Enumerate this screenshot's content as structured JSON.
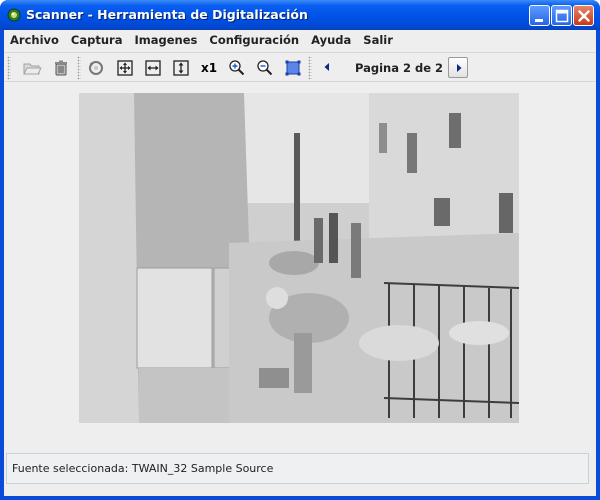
{
  "window": {
    "title": "Scanner - Herramienta de Digitalización"
  },
  "menu": [
    "Archivo",
    "Captura",
    "Imagenes",
    "Configuración",
    "Ayuda",
    "Salir"
  ],
  "toolbar": {
    "zoom_actual_label": "x1",
    "page_label": "Pagina 2 de 2"
  },
  "status": {
    "text": "Fuente seleccionada: TWAIN_32 Sample Source"
  },
  "colors": {
    "title_bar": "#0052e7",
    "close_button": "#c8391b",
    "client_bg": "#eeeeee"
  }
}
